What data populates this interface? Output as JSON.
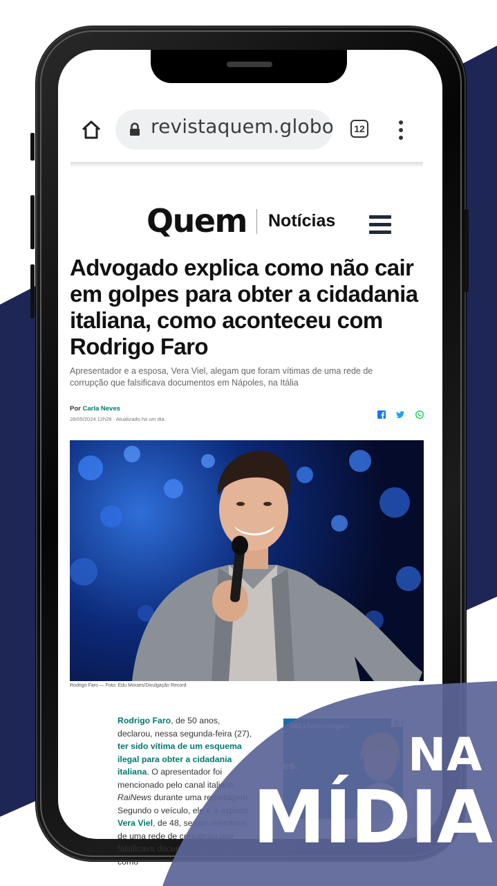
{
  "colors": {
    "navy": "#1e2656",
    "overlay": "#5b6597",
    "link_teal": "#00796b",
    "facebook": "#1877f2",
    "twitter": "#1da1f2",
    "whatsapp": "#25d366"
  },
  "browser": {
    "url": "revistaquem.globo.",
    "tab_count": "12",
    "icons": [
      "home-icon",
      "lock-icon",
      "tabs-icon",
      "more-vert-icon"
    ]
  },
  "site": {
    "logo": "Quem",
    "section": "Notícias"
  },
  "article": {
    "headline": "Advogado explica como não cair em golpes para obter a cidadania italiana, como aconteceu com Rodrigo Faro",
    "subtitle": "Apresentador e a esposa, Vera Viel, alegam que foram vítimas de uma rede de corrupção que falsificava documentos em Nápoles, na Itália",
    "byline_prefix": "Por ",
    "author": "Carla Neves",
    "dateline": "28/05/2024 12h28 · Atualizado há um dia",
    "photo_caption": "Rodrigo Faro — Foto: Edu Moraes/Divulgação Record",
    "body": {
      "p1_link1": "Rodrigo Faro",
      "p1_t1": ", de 50 anos, declarou, nessa segunda-feira (27), ",
      "p1_link2": "ter sido vítima de um esquema ilegal para obter a cidadania italiana",
      "p1_t2": ". O apresentador foi mencionado pelo canal italiano ",
      "p1_em": "RaiNews",
      "p1_t3": " durante uma reportagem. Segundo o veículo, ele e a esposa, ",
      "p1_link3": "Vera Viel",
      "p1_t4": ", de 48, seriam membros de uma rede de corrupção que falsificava documentos públicos, como"
    }
  },
  "ad": {
    "brand": "DELLTechnologies",
    "text": "es.",
    "close": "⊠"
  },
  "overlay": {
    "line1": "NA",
    "line2": "MÍDIA"
  }
}
